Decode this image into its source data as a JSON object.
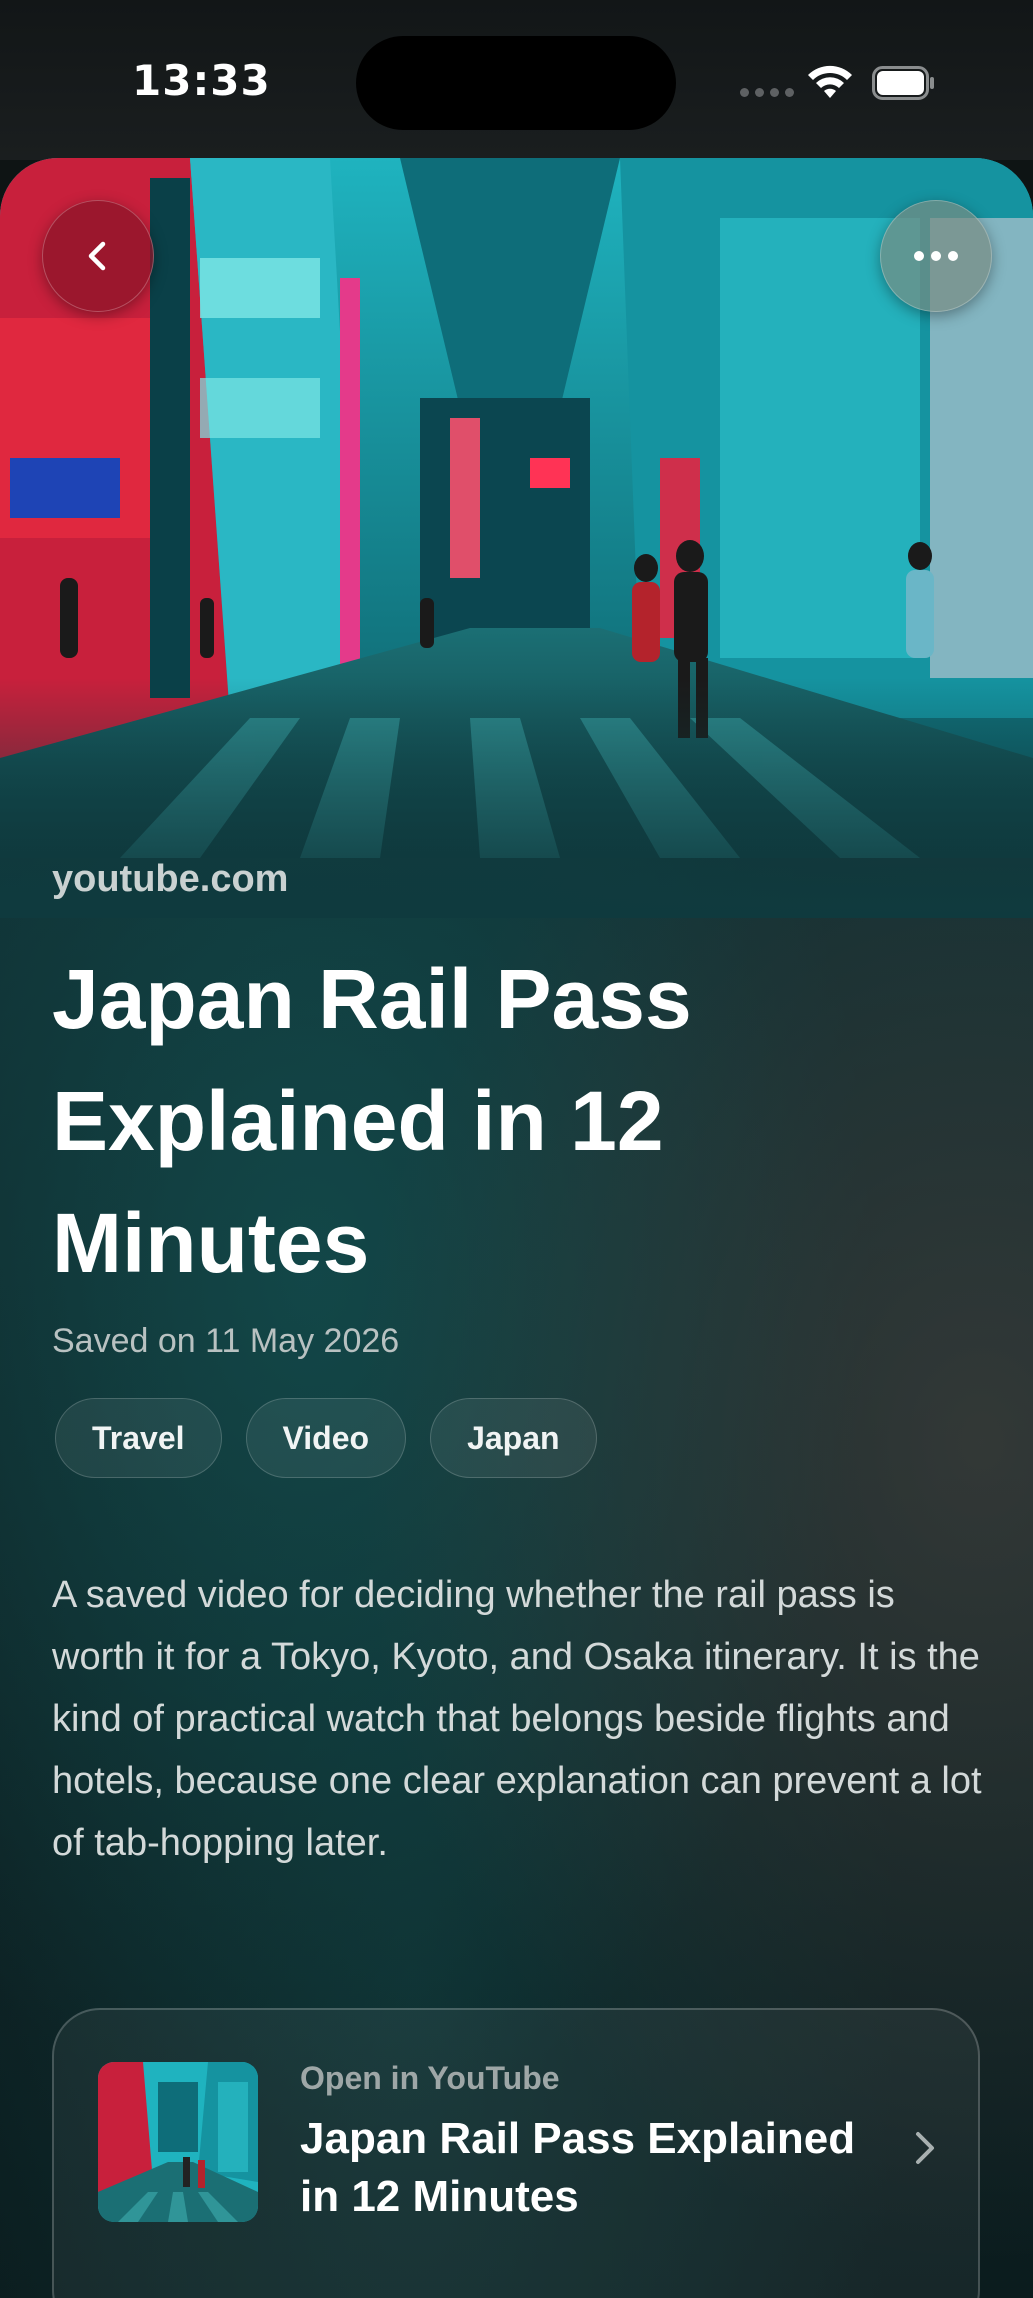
{
  "status_bar": {
    "time": "13:33"
  },
  "article": {
    "source": "youtube.com",
    "title": "Japan Rail Pass Explained in 12 Minutes",
    "saved_date": "Saved on 11 May 2026",
    "tags": [
      "Travel",
      "Video",
      "Japan"
    ],
    "description": "A saved video for deciding whether the rail pass is worth it for a Tokyo, Kyoto, and Osaka itinerary. It is the kind of practical watch that belongs beside flights and hotels, because one clear explanation can prevent a lot of tab-hopping later."
  },
  "link_card": {
    "label": "Open in YouTube",
    "title": "Japan Rail Pass Explained in 12 Minutes"
  },
  "icons": {
    "back": "chevron-left-icon",
    "more": "more-horizontal-icon",
    "open": "chevron-right-icon"
  },
  "colors": {
    "background": "#0e1414",
    "accent_back_button": "#8c1428",
    "card_gradient_top": "#0f3a3e"
  }
}
